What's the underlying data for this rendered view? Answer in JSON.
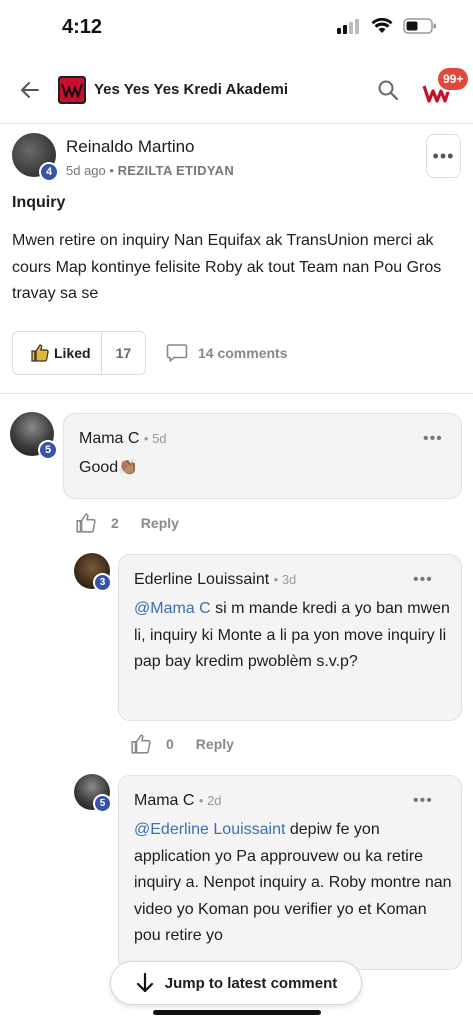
{
  "status_bar": {
    "time": "4:12"
  },
  "header": {
    "title": "Yes Yes Yes Kredi Akademi",
    "notification_badge": "99+"
  },
  "post": {
    "author": "Reinaldo Martino",
    "author_level": "4",
    "time": "5d ago",
    "meta_separator": "•",
    "category": "REZILTA ETIDYAN",
    "more_label": "•••",
    "title": "Inquiry",
    "body": "Mwen retire on inquiry Nan Equifax ak TransUnion merci ak cours Map kontinye felisite Roby ak tout Team nan Pou Gros travay sa se",
    "like_label": "Liked",
    "like_count": "17",
    "comments_label": "14 comments"
  },
  "comments": [
    {
      "author": "Mama C",
      "level": "5",
      "time": "• 5d",
      "text": "Good👏🏽",
      "more": "•••",
      "likes": "2",
      "reply_label": "Reply"
    },
    {
      "author": "Ederline Louissaint",
      "level": "3",
      "time": "• 3d",
      "mention": "@Mama C",
      "text": " si m mande kredi a yo ban mwen li, inquiry ki Monte a li pa yon move inquiry li pap bay kredim pwoblèm s.v.p?",
      "more": "•••",
      "likes": "0",
      "reply_label": "Reply"
    },
    {
      "author": "Mama C",
      "level": "5",
      "time": "• 2d",
      "mention": "@Ederline Louissaint",
      "text": " depiw fe yon application yo Pa approuvew ou ka retire inquiry a. Nenpot inquiry a. Roby montre nan video yo Koman pou verifier yo et Koman pou retire yo",
      "more": "•••"
    }
  ],
  "jump_button": {
    "label": "Jump to latest comment"
  },
  "colors": {
    "accent": "#3b6fb6",
    "badge": "#e0483e",
    "level": "#3553a8",
    "brand": "#c8102e"
  }
}
